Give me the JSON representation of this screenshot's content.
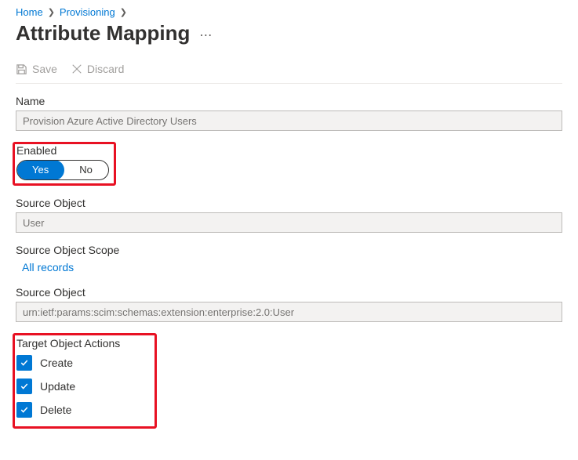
{
  "breadcrumb": {
    "items": [
      "Home",
      "Provisioning"
    ]
  },
  "header": {
    "title": "Attribute Mapping"
  },
  "toolbar": {
    "save_label": "Save",
    "discard_label": "Discard"
  },
  "form": {
    "name_label": "Name",
    "name_value": "Provision Azure Active Directory Users",
    "enabled_label": "Enabled",
    "enabled_yes": "Yes",
    "enabled_no": "No",
    "enabled_value": true,
    "source_object_label": "Source Object",
    "source_object_value": "User",
    "source_object_scope_label": "Source Object Scope",
    "source_object_scope_value": "All records",
    "target_schema_label": "Source Object",
    "target_schema_value": "urn:ietf:params:scim:schemas:extension:enterprise:2.0:User",
    "target_actions_label": "Target Object Actions",
    "target_actions": {
      "create_label": "Create",
      "update_label": "Update",
      "delete_label": "Delete",
      "create_checked": true,
      "update_checked": true,
      "delete_checked": true
    }
  }
}
